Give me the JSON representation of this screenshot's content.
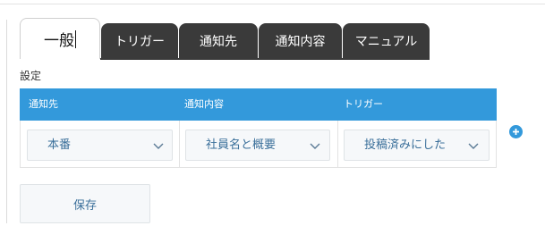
{
  "tabs": [
    {
      "label": "一般",
      "active": true
    },
    {
      "label": "トリガー",
      "active": false
    },
    {
      "label": "通知先",
      "active": false
    },
    {
      "label": "通知内容",
      "active": false
    },
    {
      "label": "マニュアル",
      "active": false
    }
  ],
  "section_label": "設定",
  "table": {
    "headers": [
      "通知先",
      "通知内容",
      "トリガー"
    ],
    "row": {
      "destination": "本番",
      "content": "社員名と概要",
      "trigger": "投稿済みにした"
    }
  },
  "add_icon": "plus-circle-icon",
  "save_label": "保存",
  "colors": {
    "accent": "#3399db",
    "tab_dark": "#3a3a3a",
    "link_text": "#3a6f9a"
  }
}
